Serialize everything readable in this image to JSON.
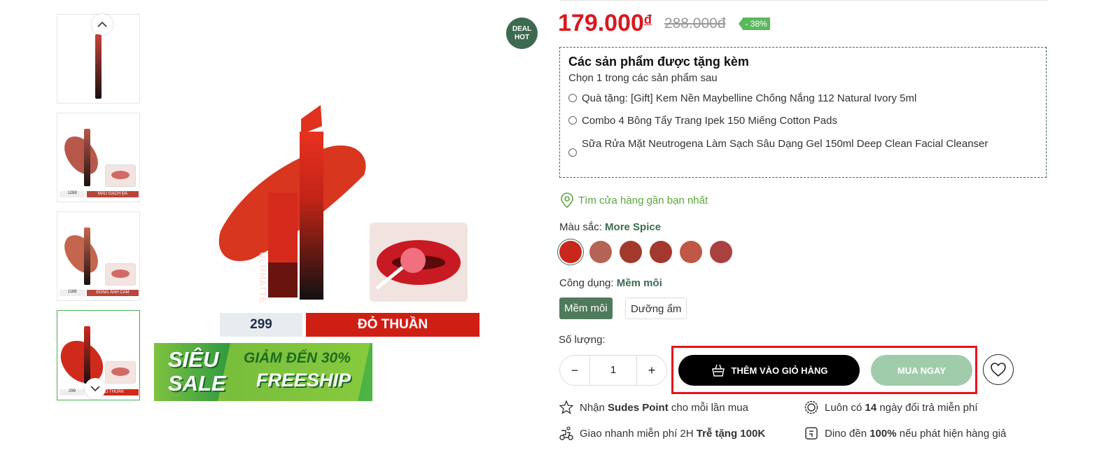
{
  "badge": {
    "line1": "DEAL",
    "line2": "HOT"
  },
  "thumbnails": [
    {
      "num": "",
      "name": ""
    },
    {
      "num": "1288",
      "name": "MÀU GẠCH ĐÁ"
    },
    {
      "num": "1188",
      "name": "ĐỒNG ÁNH CAM"
    },
    {
      "num": "299",
      "name": "ĐỎ THUẦN"
    }
  ],
  "main_image": {
    "shade_num": "299",
    "shade_name": "ĐỎ THUẦN",
    "brand_vertical": "ULTIMATTE",
    "banner_sieu": "SIÊU",
    "banner_sale": "SALE",
    "banner_giam": "GIẢM ĐẾN 30%",
    "banner_freeship": "FREESHIP"
  },
  "price": {
    "current": "179.000",
    "currency": "đ",
    "old": "288.000đ",
    "discount": "- 38%"
  },
  "gift": {
    "title": "Các sản phẩm được tặng kèm",
    "subtitle": "Chọn 1 trong các sản phẩm sau",
    "options": [
      "Quà tặng: [Gift] Kem Nền Maybelline Chống Nắng 112 Natural Ivory 5ml",
      "Combo 4 Bông Tẩy Trang Ipek 150 Miếng Cotton Pads",
      "Sữa Rửa Mặt Neutrogena Làm Sạch Sâu Dạng Gel 150ml Deep Clean Facial Cleanser"
    ]
  },
  "store_link": "Tìm cửa hàng gần bạn nhất",
  "color": {
    "label": "Màu sắc:",
    "selected": "More Spice",
    "swatches": [
      "#c8271b",
      "#b46454",
      "#a23a2c",
      "#a3392e",
      "#bf5845",
      "#a8413f"
    ]
  },
  "usage": {
    "label": "Công dụng:",
    "selected": "Mềm môi",
    "options": [
      "Mềm môi",
      "Dưỡng ẩm"
    ]
  },
  "quantity": {
    "label": "Số lượng:",
    "minus": "−",
    "value": "1",
    "plus": "+"
  },
  "actions": {
    "add_to_cart": "THÊM VÀO GIỎ HÀNG",
    "buy_now": "MUA NGAY"
  },
  "features": {
    "f1_pre": "Nhận ",
    "f1_bold": "Sudes Point",
    "f1_post": " cho mỗi lần mua",
    "f2_pre": "Luôn có ",
    "f2_bold": "14",
    "f2_post": " ngày đổi trả miễn phí",
    "f3_pre": "Giao nhanh miễn phí 2H ",
    "f3_bold": "Trễ tặng 100K",
    "f4_pre": "Dino đền ",
    "f4_bold": "100%",
    "f4_post": " nếu phát hiện hàng giả"
  },
  "colors": {
    "price_red": "#d71920",
    "brand_green": "#4a7a5a",
    "link_green": "#5aa73c",
    "highlight_red": "#e8141b"
  }
}
